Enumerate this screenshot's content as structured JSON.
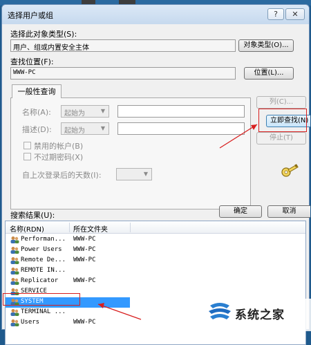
{
  "window": {
    "title": "选择用户或组",
    "help_label": "?",
    "close_label": "✕"
  },
  "object_type": {
    "label": "选择此对象类型(S):",
    "value": "用户、组或内置安全主体",
    "button": "对象类型(O)..."
  },
  "location": {
    "label": "查找位置(F):",
    "value": "WWW-PC",
    "button": "位置(L)..."
  },
  "tab": {
    "label": "一般性查询"
  },
  "query": {
    "name_label": "名称(A):",
    "name_mode": "起始为",
    "desc_label": "描述(D):",
    "desc_mode": "起始为",
    "disabled_accounts": "禁用的帐户(B)",
    "non_expiring_pw": "不过期密码(X)",
    "days_label": "自上次登录后的天数(I):"
  },
  "buttons": {
    "columns": "列(C)...",
    "find_now": "立即查找(N)",
    "stop": "停止(T)",
    "ok": "确定",
    "cancel": "取消"
  },
  "results": {
    "label": "搜索结果(U):",
    "columns": [
      "名称(RDN)",
      "所在文件夹"
    ],
    "rows": [
      {
        "name": "Performan...",
        "folder": "WWW-PC"
      },
      {
        "name": "Power Users",
        "folder": "WWW-PC"
      },
      {
        "name": "Remote De...",
        "folder": "WWW-PC"
      },
      {
        "name": "REMOTE IN...",
        "folder": ""
      },
      {
        "name": "Replicator",
        "folder": "WWW-PC"
      },
      {
        "name": "SERVICE",
        "folder": ""
      },
      {
        "name": "SYSTEM",
        "folder": ""
      },
      {
        "name": "TERMINAL ...",
        "folder": ""
      },
      {
        "name": "Users",
        "folder": "WWW-PC"
      }
    ],
    "selected_row": "SYSTEM"
  },
  "watermark": {
    "text": "系统之家"
  },
  "colors": {
    "selection": "#3399ff",
    "annotation": "#d81e1e"
  }
}
